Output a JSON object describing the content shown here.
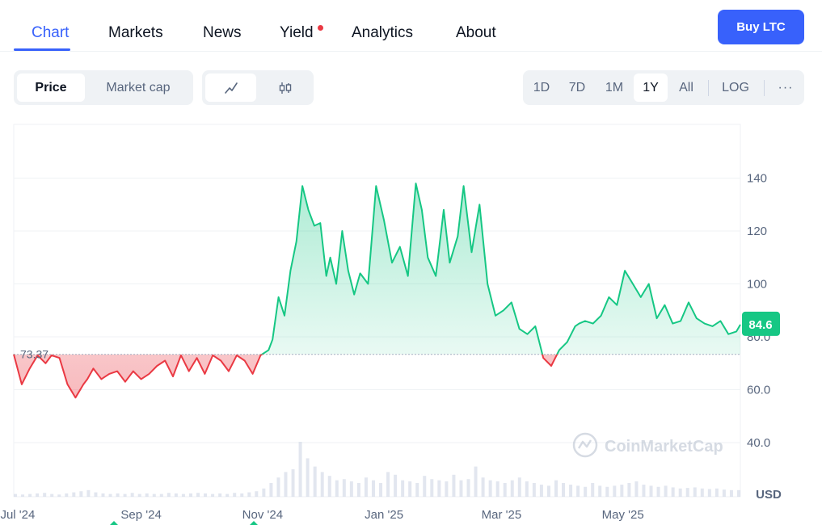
{
  "nav": {
    "tabs": [
      "Chart",
      "Markets",
      "News",
      "Yield",
      "Analytics",
      "About"
    ],
    "active": "Chart",
    "buy_label": "Buy LTC"
  },
  "toolbar": {
    "metric_tabs": [
      "Price",
      "Market cap"
    ],
    "active_metric": "Price",
    "chart_types": [
      "line-chart-icon",
      "candlestick-icon"
    ],
    "active_chart_type": "line-chart-icon",
    "ranges": [
      "1D",
      "7D",
      "1M",
      "1Y",
      "All"
    ],
    "active_range": "1Y",
    "scale_label": "LOG",
    "more_label": "···"
  },
  "colors": {
    "accent": "#3861fb",
    "up": "#16c784",
    "down": "#ea3943"
  },
  "chart_data": {
    "type": "area",
    "baseline": 73.37,
    "baseline_label": "73.37",
    "current_value_label": "84.6",
    "y_axis_ticks": [
      "140",
      "120",
      "100",
      "80.0",
      "60.0",
      "40.0"
    ],
    "y_unit": "USD",
    "ylim": [
      20,
      160
    ],
    "x_tick_labels": [
      "Jul '24",
      "Sep '24",
      "Nov '24",
      "Jan '25",
      "Mar '25",
      "May '25"
    ],
    "x_tick_dates": [
      "2024-07-01",
      "2024-09-01",
      "2024-11-01",
      "2025-01-01",
      "2025-03-01",
      "2025-05-01"
    ],
    "watermark": "CoinMarketCap",
    "grid": true,
    "series": [
      {
        "dates": [
          "2024-06-29",
          "2024-07-03",
          "2024-07-07",
          "2024-07-11",
          "2024-07-15",
          "2024-07-18",
          "2024-07-22",
          "2024-07-26",
          "2024-07-30",
          "2024-08-03",
          "2024-08-05",
          "2024-08-08",
          "2024-08-12",
          "2024-08-16",
          "2024-08-20",
          "2024-08-24",
          "2024-08-28",
          "2024-09-01",
          "2024-09-05",
          "2024-09-09",
          "2024-09-13",
          "2024-09-17",
          "2024-09-21",
          "2024-09-25",
          "2024-09-29",
          "2024-10-03",
          "2024-10-07",
          "2024-10-11",
          "2024-10-15",
          "2024-10-19",
          "2024-10-23",
          "2024-10-27",
          "2024-10-31",
          "2024-11-04",
          "2024-11-06",
          "2024-11-09",
          "2024-11-12",
          "2024-11-15",
          "2024-11-18",
          "2024-11-21",
          "2024-11-24",
          "2024-11-27",
          "2024-11-30",
          "2024-12-03",
          "2024-12-05",
          "2024-12-08",
          "2024-12-11",
          "2024-12-14",
          "2024-12-17",
          "2024-12-20",
          "2024-12-24",
          "2024-12-28",
          "2025-01-01",
          "2025-01-05",
          "2025-01-09",
          "2025-01-13",
          "2025-01-17",
          "2025-01-20",
          "2025-01-23",
          "2025-01-27",
          "2025-01-31",
          "2025-02-03",
          "2025-02-07",
          "2025-02-10",
          "2025-02-14",
          "2025-02-18",
          "2025-02-22",
          "2025-02-26",
          "2025-03-02",
          "2025-03-06",
          "2025-03-10",
          "2025-03-14",
          "2025-03-18",
          "2025-03-22",
          "2025-03-26",
          "2025-03-30",
          "2025-04-03",
          "2025-04-07",
          "2025-04-09",
          "2025-04-12",
          "2025-04-16",
          "2025-04-20",
          "2025-04-24",
          "2025-04-28",
          "2025-05-02",
          "2025-05-06",
          "2025-05-10",
          "2025-05-14",
          "2025-05-18",
          "2025-05-22",
          "2025-05-26",
          "2025-05-30",
          "2025-06-03",
          "2025-06-07",
          "2025-06-11",
          "2025-06-15",
          "2025-06-19",
          "2025-06-23",
          "2025-06-27",
          "2025-06-29"
        ],
        "values": [
          73.4,
          62,
          68,
          73,
          70,
          73,
          72,
          62,
          57,
          62,
          64,
          68,
          64,
          66,
          67,
          63,
          67,
          64,
          66,
          69,
          71,
          65,
          73,
          67,
          72,
          66,
          73,
          71,
          67,
          73,
          71,
          66,
          73,
          75,
          79,
          95,
          88,
          105,
          116,
          137,
          128,
          122,
          123,
          103,
          110,
          100,
          120,
          105,
          96,
          104,
          100,
          137,
          124,
          108,
          114,
          103,
          138,
          128,
          110,
          103,
          128,
          108,
          118,
          137,
          112,
          130,
          100,
          88,
          90,
          93,
          83,
          81,
          84,
          72,
          69,
          75,
          78,
          84,
          85,
          86,
          85,
          88,
          95,
          92,
          105,
          100,
          95,
          100,
          87,
          92,
          85,
          86,
          93,
          87,
          85,
          84,
          86,
          81,
          82,
          84.6
        ]
      }
    ],
    "volume_relative": [
      0.05,
      0.04,
      0.05,
      0.06,
      0.07,
      0.05,
      0.04,
      0.06,
      0.08,
      0.1,
      0.12,
      0.08,
      0.06,
      0.05,
      0.06,
      0.05,
      0.07,
      0.05,
      0.06,
      0.05,
      0.05,
      0.07,
      0.06,
      0.05,
      0.06,
      0.07,
      0.06,
      0.05,
      0.06,
      0.05,
      0.07,
      0.06,
      0.08,
      0.1,
      0.15,
      0.25,
      0.35,
      0.45,
      0.5,
      1.0,
      0.7,
      0.55,
      0.45,
      0.38,
      0.3,
      0.32,
      0.28,
      0.25,
      0.35,
      0.3,
      0.25,
      0.45,
      0.4,
      0.3,
      0.28,
      0.25,
      0.38,
      0.32,
      0.3,
      0.28,
      0.4,
      0.3,
      0.32,
      0.55,
      0.35,
      0.3,
      0.28,
      0.25,
      0.3,
      0.35,
      0.28,
      0.25,
      0.22,
      0.2,
      0.3,
      0.25,
      0.22,
      0.2,
      0.18,
      0.25,
      0.2,
      0.18,
      0.2,
      0.22,
      0.25,
      0.28,
      0.22,
      0.2,
      0.18,
      0.2,
      0.17,
      0.15,
      0.16,
      0.17,
      0.15,
      0.14,
      0.15,
      0.13,
      0.12,
      0.12
    ]
  }
}
